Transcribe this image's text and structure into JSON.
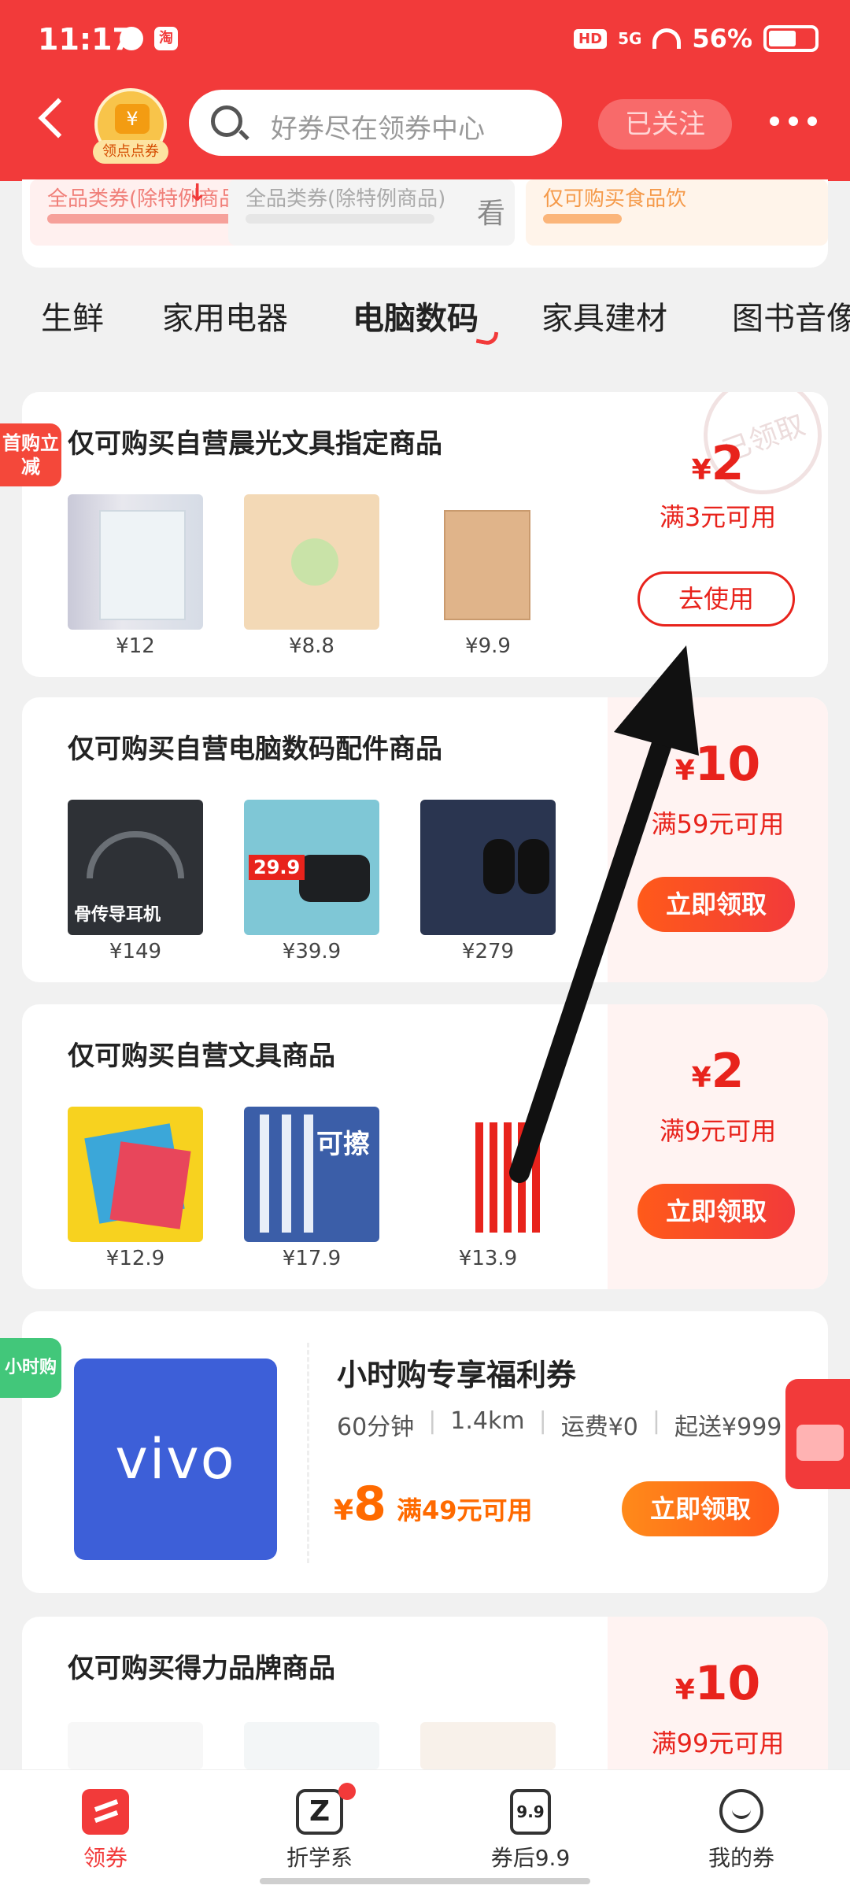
{
  "status_bar": {
    "time": "11:17",
    "network": "5G",
    "battery": "56%",
    "tao_badge": "淘",
    "hd_badge": "HD"
  },
  "header": {
    "logo_label": "领点点券",
    "logo_symbol": "¥",
    "search_placeholder": "好券尽在领券中心",
    "follow_label": "已关注"
  },
  "top_strip": {
    "items": [
      {
        "text": "全品类券(除特例商品)"
      },
      {
        "text": "全品类券(除特例商品)",
        "side": "看"
      },
      {
        "text": "仅可购买食品饮"
      }
    ]
  },
  "tabs": [
    "生鲜",
    "家用电器",
    "电脑数码",
    "家具建材",
    "图书音像"
  ],
  "active_tab": "电脑数码",
  "coupons": [
    {
      "tag": "首购立减",
      "title": "仅可购买自营晨光文具指定商品",
      "products": [
        {
          "price": "¥12"
        },
        {
          "price": "¥8.8"
        },
        {
          "price": "¥9.9"
        }
      ],
      "currency": "¥",
      "amount": "2",
      "condition": "满3元可用",
      "button": "去使用",
      "stamp": "已领取"
    },
    {
      "title": "仅可购买自营电脑数码配件商品",
      "products": [
        {
          "price": "¥149",
          "caption": "骨传导耳机"
        },
        {
          "price": "¥39.9",
          "caption": "29.9"
        },
        {
          "price": "¥279"
        }
      ],
      "currency": "¥",
      "amount": "10",
      "condition": "满59元可用",
      "button": "立即领取"
    },
    {
      "title": "仅可购买自营文具商品",
      "products": [
        {
          "price": "¥12.9"
        },
        {
          "price": "¥17.9",
          "caption": "可擦"
        },
        {
          "price": "¥13.9"
        }
      ],
      "currency": "¥",
      "amount": "2",
      "condition": "满9元可用",
      "button": "立即领取"
    },
    {
      "title": "仅可购买得力品牌商品",
      "currency": "¥",
      "amount": "10",
      "condition": "满99元可用"
    }
  ],
  "hourly": {
    "tag": "小时购",
    "brand": "vivo",
    "title": "小时购专享福利券",
    "meta": [
      "60分钟",
      "1.4km",
      "运费¥0",
      "起送¥999"
    ],
    "currency": "¥",
    "amount": "8",
    "condition": "满49元可用",
    "button": "立即领取"
  },
  "bottom_nav": [
    {
      "label": "领券",
      "icon": "coupon-icon"
    },
    {
      "label": "折学系",
      "icon": "z-icon"
    },
    {
      "label": "券后9.9",
      "icon": "price-tag-icon",
      "icon_text": "9.9"
    },
    {
      "label": "我的券",
      "icon": "smile-icon"
    }
  ],
  "colors": {
    "primary": "#f23a3a",
    "orange": "#ff6a00",
    "vivo_blue": "#3d5fd8"
  }
}
